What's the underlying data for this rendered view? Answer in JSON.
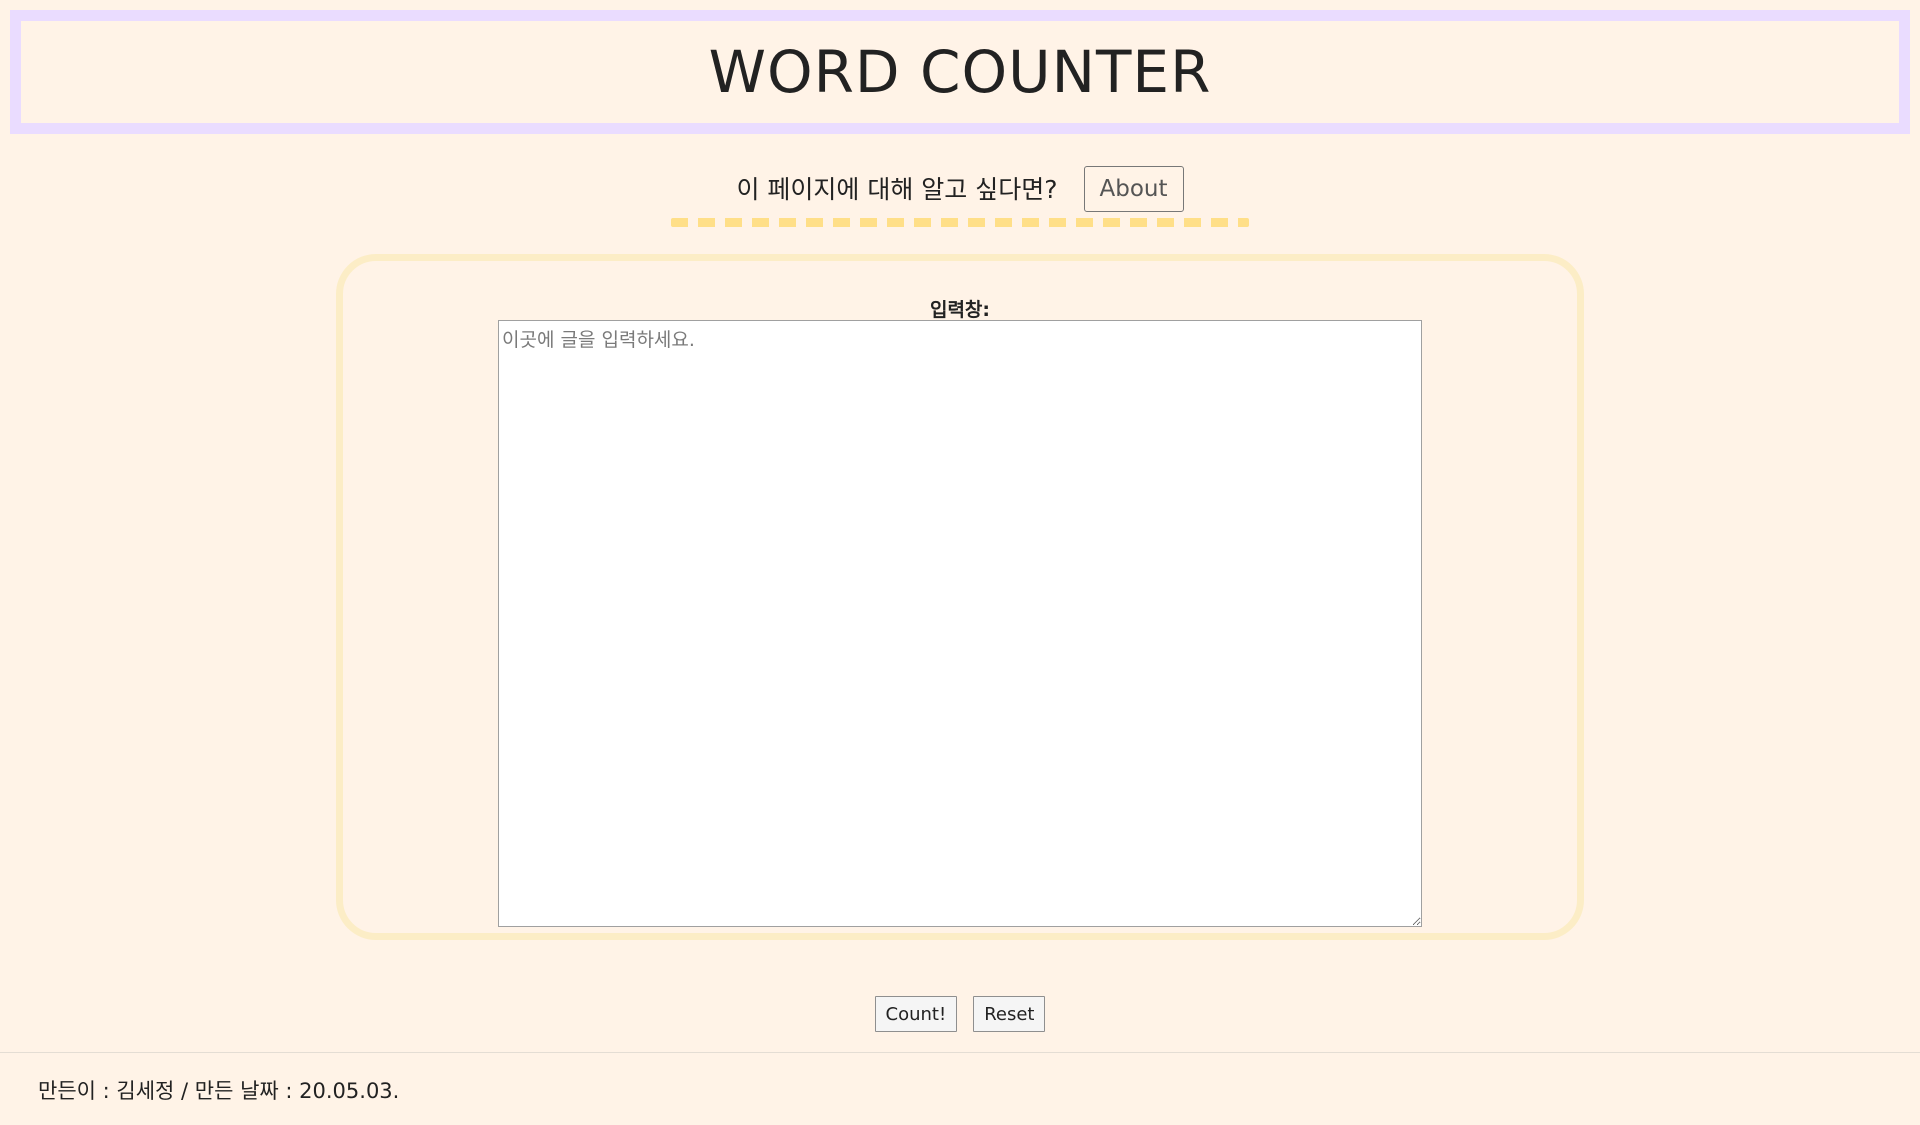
{
  "header": {
    "title": "WORD COUNTER"
  },
  "about": {
    "prompt": "이 페이지에 대해 알고 싶다면?",
    "button_label": "About"
  },
  "input": {
    "label": "입력창:",
    "value": "",
    "placeholder": "이곳에 글을 입력하세요."
  },
  "actions": {
    "count_label": "Count!",
    "reset_label": "Reset"
  },
  "footer": {
    "credit": "만든이 : 김세정 / 만든 날짜 : 20.05.03."
  },
  "colors": {
    "background": "#fff3e7",
    "header_border": "#eadcff",
    "dash_accent": "#ffdf88",
    "panel_border": "#fcedc6"
  }
}
